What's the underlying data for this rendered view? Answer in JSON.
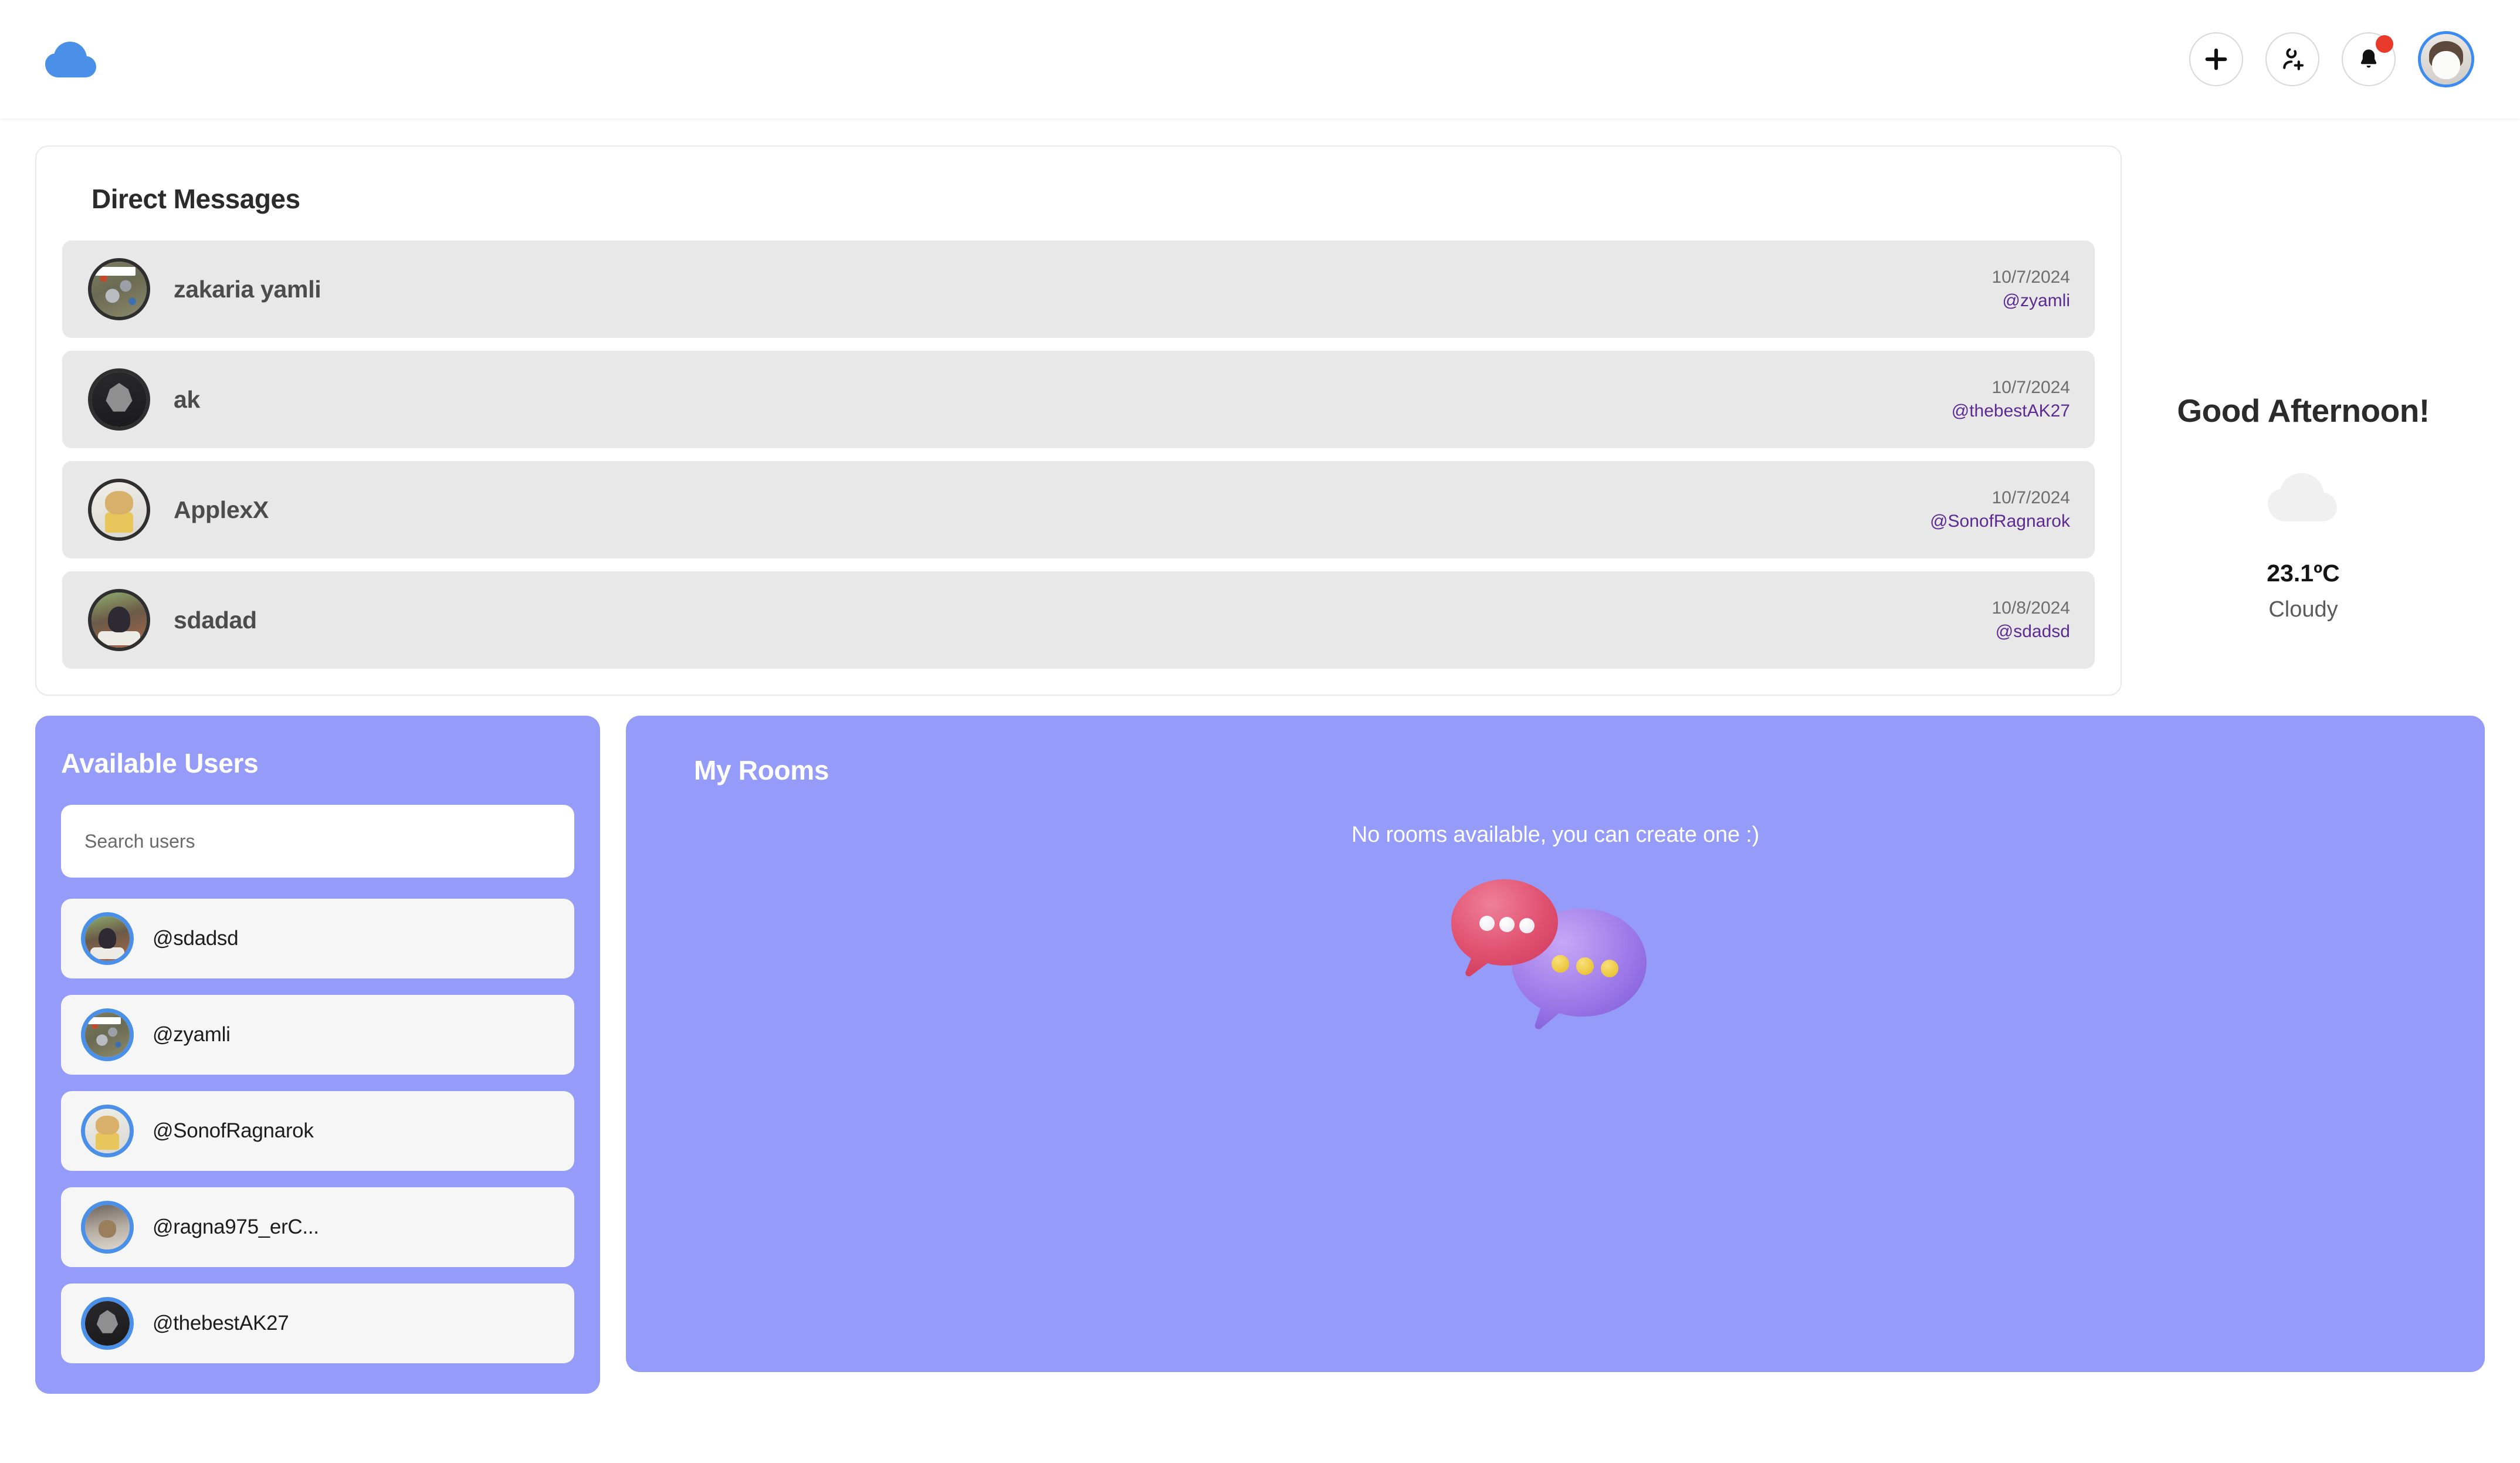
{
  "header": {
    "logo_icon": "cloud-logo",
    "add_icon": "plus-icon",
    "add_user_icon": "add-user-icon",
    "notifications_icon": "bell-icon",
    "notification_badge": "",
    "avatar_alt": "user-avatar"
  },
  "direct_messages": {
    "title": "Direct Messages",
    "rows": [
      {
        "name": "zakaria yamli",
        "date": "10/7/2024",
        "handle": "@zyamli"
      },
      {
        "name": "ak",
        "date": "10/7/2024",
        "handle": "@thebestAK27"
      },
      {
        "name": "ApplexX",
        "date": "10/7/2024",
        "handle": "@SonofRagnarok"
      },
      {
        "name": "sdadad",
        "date": "10/8/2024",
        "handle": "@sdadsd"
      }
    ]
  },
  "weather": {
    "greeting": "Good Afternoon!",
    "icon": "cloud-icon",
    "temperature": "23.1ºC",
    "condition": "Cloudy"
  },
  "available_users": {
    "title": "Available Users",
    "search_placeholder": "Search users",
    "search_value": "",
    "items": [
      {
        "handle": "@sdadsd"
      },
      {
        "handle": "@zyamli"
      },
      {
        "handle": "@SonofRagnarok"
      },
      {
        "handle": "@ragna975_erC..."
      },
      {
        "handle": "@thebestAK27"
      }
    ]
  },
  "my_rooms": {
    "title": "My Rooms",
    "empty_text": "No rooms available, you can create one :)",
    "illustration": "speech-bubbles-illustration"
  },
  "colors": {
    "accent_purple": "#949BF8",
    "handle_purple": "#5C2B91",
    "logo_blue": "#4A90E8",
    "badge_red": "#E8392B",
    "row_gray": "#E8E8E8"
  }
}
